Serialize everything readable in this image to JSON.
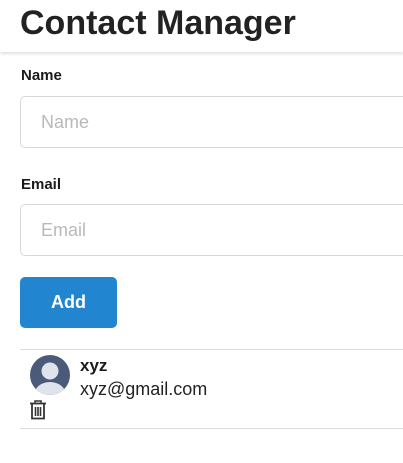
{
  "header": {
    "title": "Contact Manager"
  },
  "form": {
    "name_label": "Name",
    "name_placeholder": "Name",
    "name_value": "",
    "email_label": "Email",
    "email_placeholder": "Email",
    "email_value": "",
    "add_label": "Add"
  },
  "contacts": [
    {
      "name": "xyz",
      "email": "xyz@gmail.com",
      "avatar_icon": "user-avatar-icon",
      "delete_icon": "trash-icon"
    }
  ],
  "colors": {
    "primary_button": "#2185d0",
    "avatar": "#4a5a78"
  }
}
